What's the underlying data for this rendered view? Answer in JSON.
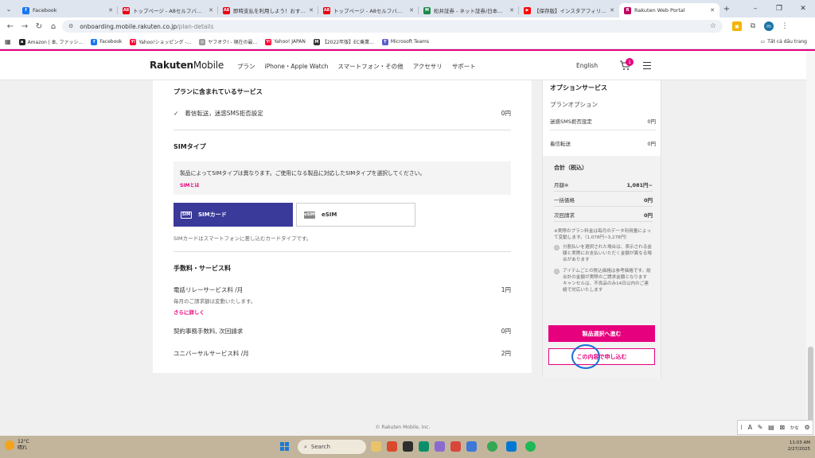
{
  "browser": {
    "tabs": [
      {
        "title": "Facebook",
        "fav_color": "#1877f2",
        "fav_text": "f"
      },
      {
        "title": "トップページ - A8セルフバック",
        "fav_color": "#e60012",
        "fav_text": "A8"
      },
      {
        "title": "即時支払を利用しよう！おすすめ",
        "fav_color": "#e60012",
        "fav_text": "A8"
      },
      {
        "title": "トップページ - A8セルフバック",
        "fav_color": "#e60012",
        "fav_text": "A8"
      },
      {
        "title": "松井証券 - ネット証券/日本株(H",
        "fav_color": "#1a8a4a",
        "fav_text": "M"
      },
      {
        "title": "【保存版】インスタアフィリエイ",
        "fav_color": "#ff0000",
        "fav_text": "▶"
      },
      {
        "title": "Rakuten Web Portal",
        "fav_color": "#bf0060",
        "fav_text": "R"
      }
    ],
    "url_host": "onboarding.mobile.rakuten.co.jp",
    "url_path": "/plan-details",
    "bookmarks": [
      {
        "label": "Amazon | 本, ファッシ...",
        "color": "#222",
        "icon": "a"
      },
      {
        "label": "Facebook",
        "color": "#1877f2",
        "icon": "f"
      },
      {
        "label": "Yahoo!ショッピング -...",
        "color": "#ff0033",
        "icon": "Y!"
      },
      {
        "label": "ヤフオク! - 現在の最...",
        "color": "#999",
        "icon": "◎"
      },
      {
        "label": "Yahoo! JAPAN",
        "color": "#ff0033",
        "icon": "Y!"
      },
      {
        "label": "【2022年版】EC乗業...",
        "color": "#333",
        "icon": "M"
      },
      {
        "label": "Microsoft Teams",
        "color": "#5b5fc7",
        "icon": "T"
      }
    ],
    "all_bookmarks": "Tất cả dấu trang"
  },
  "site": {
    "logo_bold": "Rakuten",
    "logo_light": "Mobile",
    "nav": [
      "プラン",
      "iPhone・Apple Watch",
      "スマートフォン・その他",
      "アクセサリ",
      "サポート"
    ],
    "lang": "English",
    "cart_count": "1"
  },
  "main": {
    "included_title": "プランに含まれているサービス",
    "included_item": "着信転送，迷惑SMS拒否設定",
    "included_price": "0円",
    "sim_title": "SIMタイプ",
    "sim_notice": "製品によってSIMタイプは異なります。ご使用になる製品に対応したSIMタイプを選択してください。",
    "sim_link": "SIMとは",
    "sim_card_label": "SIMカード",
    "sim_card_icon": "SIM",
    "esim_label": "eSIM",
    "esim_icon": "eSIM",
    "sim_note": "SIMカードはスマートフォンに差し込むカードタイプです。",
    "fees_title": "手数料・サービス料",
    "fee1_label": "電話リレーサービス料 /月",
    "fee1_price": "1円",
    "fee1_note": "毎月のご請求額は変動いたします。",
    "fee1_more": "さらに詳しく",
    "fee2_label": "契約事務手数料, 次回請求",
    "fee2_price": "0円",
    "fee3_label": "ユニバーサルサービス料 /月",
    "fee3_price": "2円"
  },
  "sidebar": {
    "option_title": "オプションサービス",
    "plan_option": "プランオプション",
    "opt1_label": "迷惑SMS拒否設定",
    "opt1_price": "0円",
    "opt2_label": "着信転送",
    "opt2_price": "0円",
    "total_title": "合計（税込）",
    "monthly_label": "月額※",
    "monthly_value": "1,081円~",
    "lump_label": "一括価格",
    "lump_value": "0円",
    "next_label": "次回請求",
    "next_value": "0円",
    "fine1": "※実際のプラン料金は毎月のデータ利用量によって変動します。（1,078円~3,278円）",
    "fine2": "分割払いを選択された場合は、表示される金額と実際にお支払いいただく金額が異なる場合があります",
    "fine3": "アイテムごとの税込価格は参考価格です。総合計の金額が実際のご請求金額となります\nキャンセルは、不良品のみ14日以内のご連絡で対応いたします",
    "btn_primary": "製品選択へ進む",
    "btn_secondary": "この内容で申し込む"
  },
  "footer": "© Rakuten Mobile, Inc.",
  "taskbar": {
    "temp": "12°C",
    "weather": "晴れ",
    "search": "Search",
    "time": "11:03 AM",
    "date": "2/27/2025"
  },
  "ime": {
    "a_label": "A",
    "kana": "かな"
  }
}
